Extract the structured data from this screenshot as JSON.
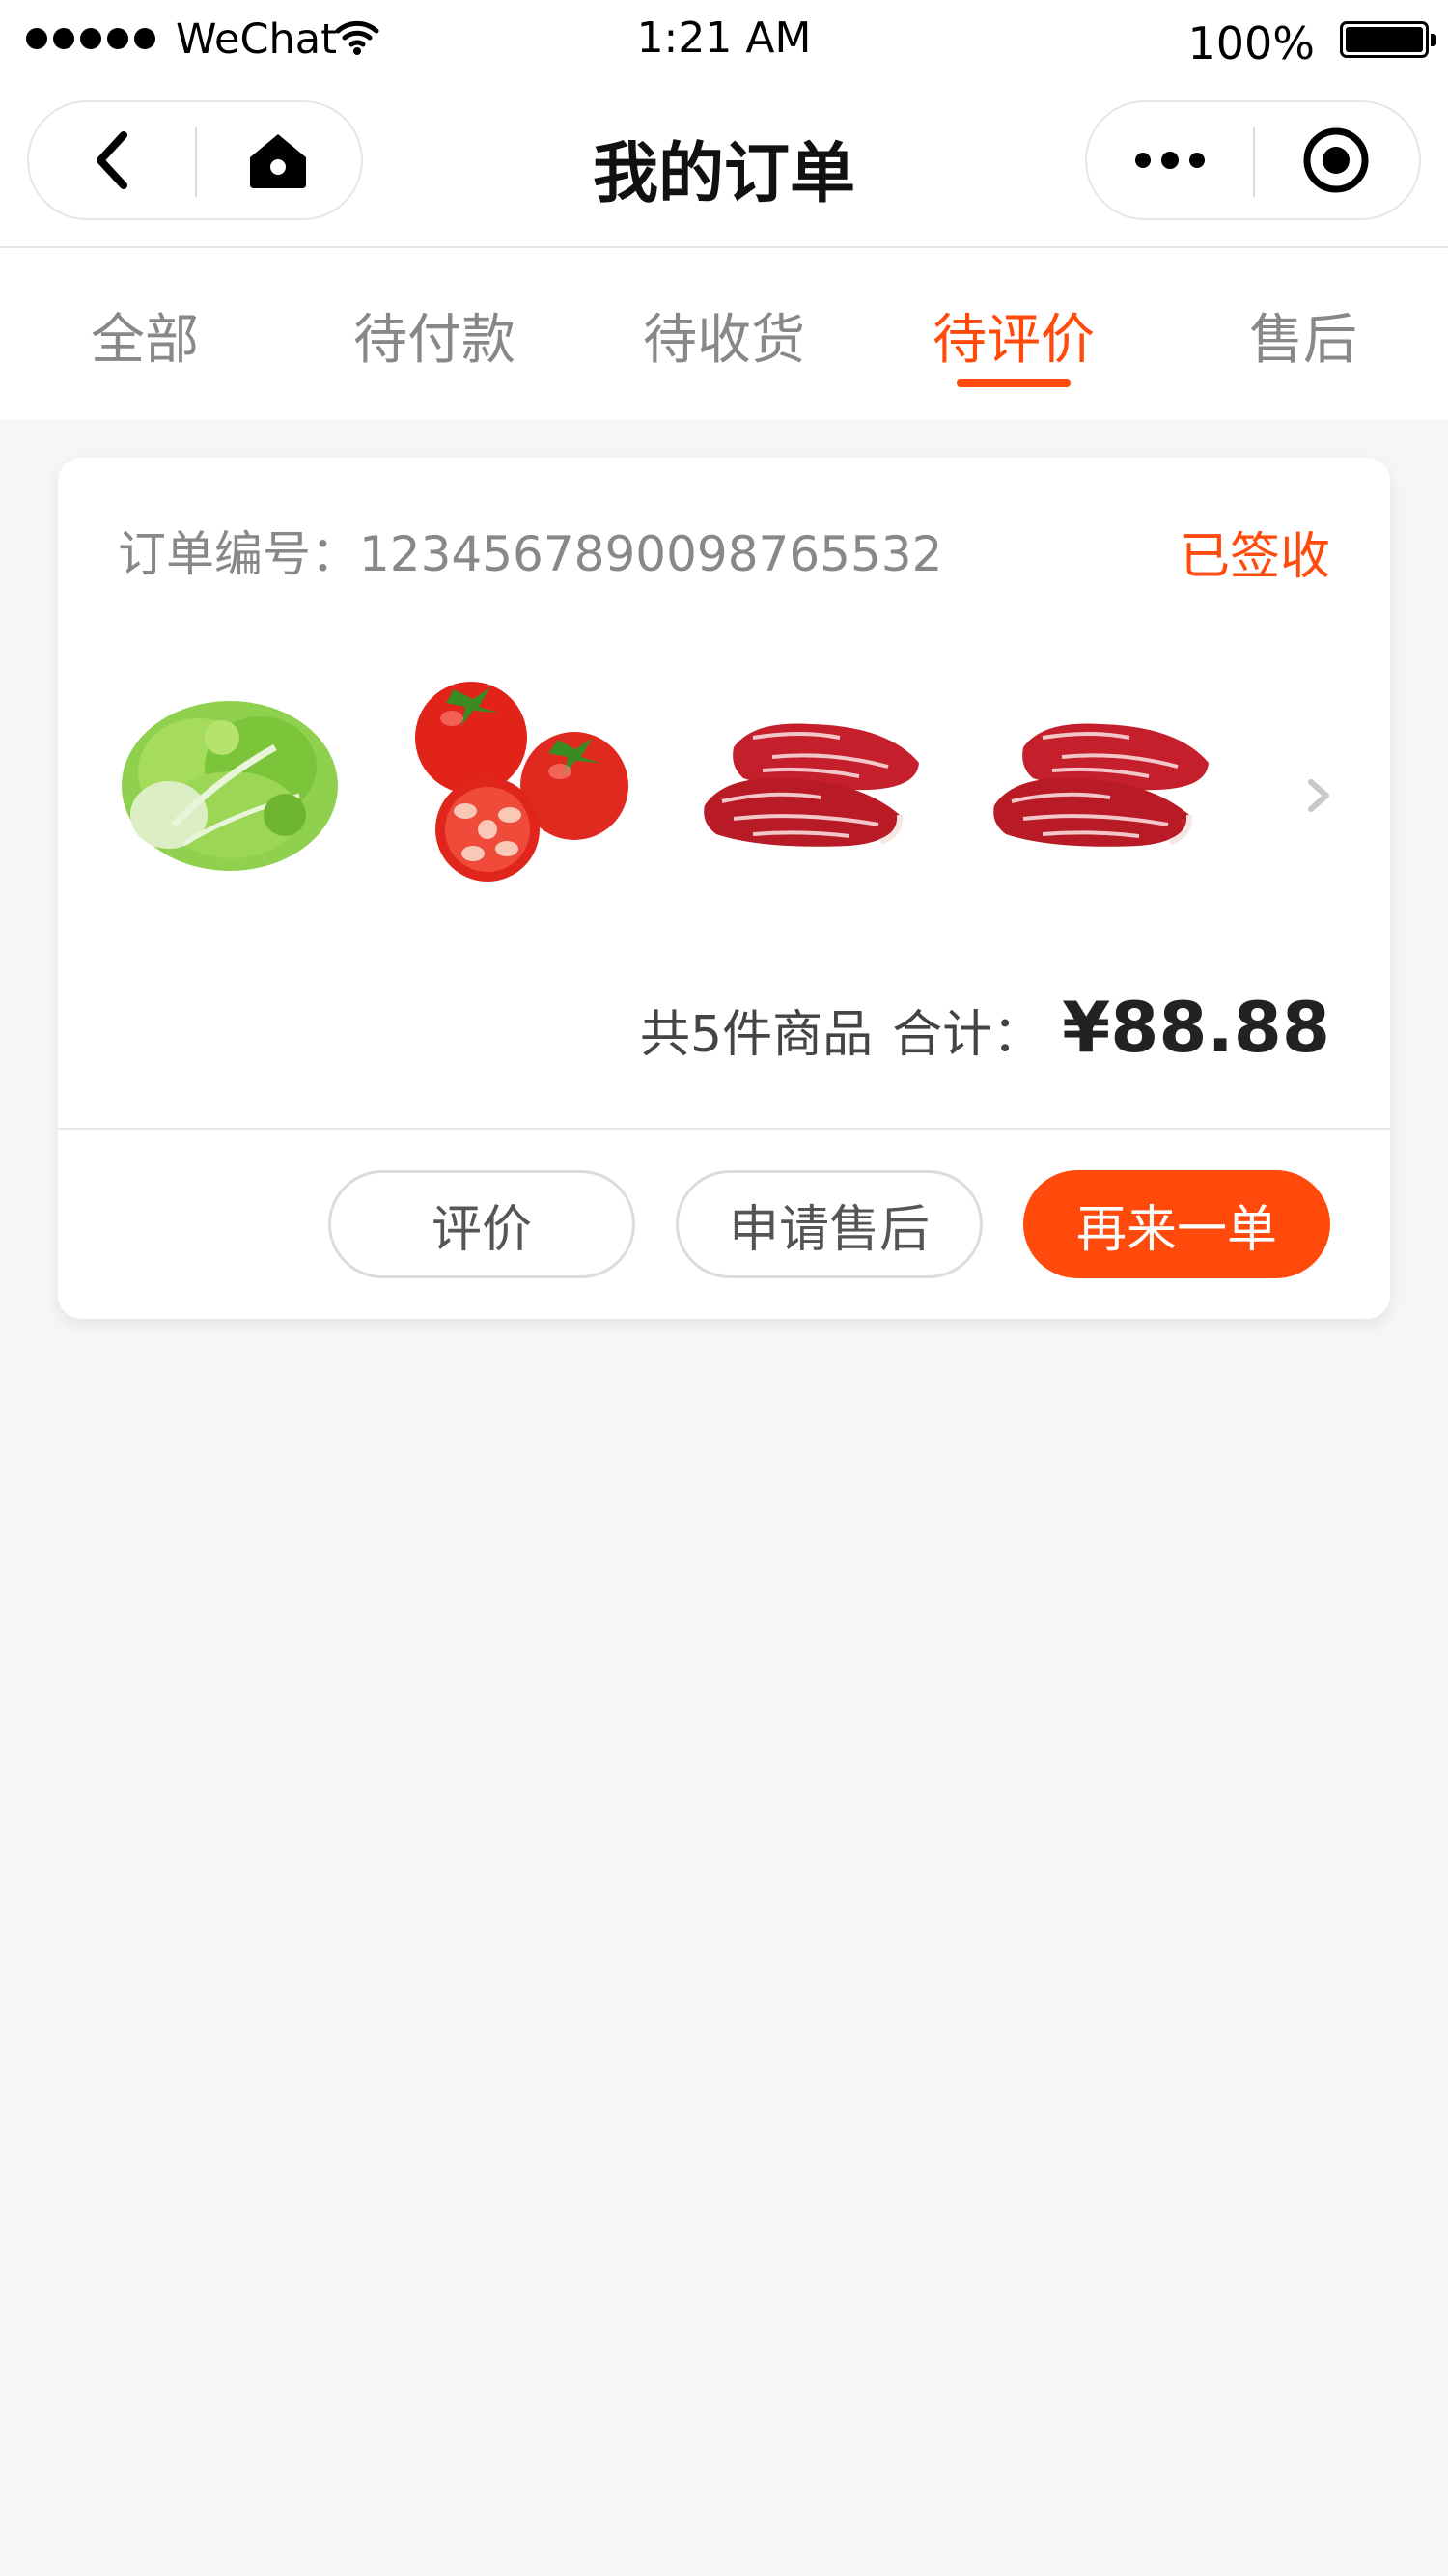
{
  "status_bar": {
    "carrier": "WeChat",
    "time": "1:21 AM",
    "battery": "100%",
    "battery_level": 1.0
  },
  "nav": {
    "title": "我的订单"
  },
  "tabs": [
    {
      "label": "全部",
      "active": false
    },
    {
      "label": "待付款",
      "active": false
    },
    {
      "label": "待收货",
      "active": false
    },
    {
      "label": "待评价",
      "active": true
    },
    {
      "label": "售后",
      "active": false
    }
  ],
  "order": {
    "number_label": "订单编号：1234567890098765532",
    "status": "已签收",
    "products": [
      {
        "icon": "lettuce-image"
      },
      {
        "icon": "tomato-image"
      },
      {
        "icon": "beef-steak-image"
      },
      {
        "icon": "beef-steak-image"
      }
    ],
    "count_text": "共5件商品",
    "total_label": "合计：",
    "total_price": "¥88.88",
    "buttons": {
      "review": "评价",
      "after_sale": "申请售后",
      "reorder": "再来一单"
    }
  },
  "colors": {
    "accent": "#ff4a0c",
    "background": "#f6f6f6"
  }
}
